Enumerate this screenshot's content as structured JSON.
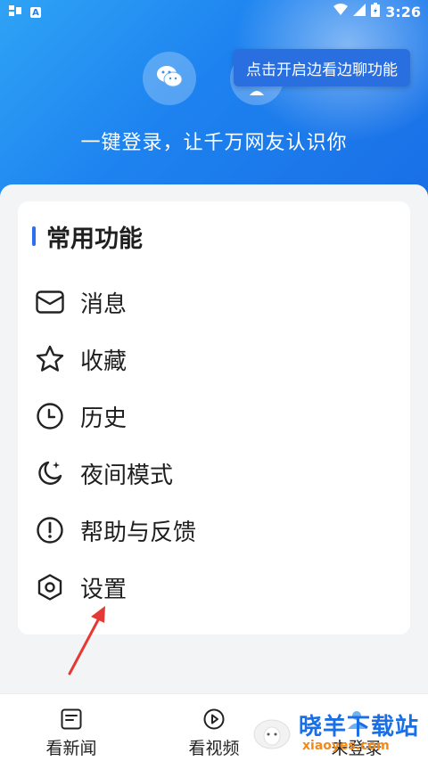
{
  "status_bar": {
    "left_icons": [
      "notification-icon",
      "a-icon"
    ],
    "a_label": "A",
    "time": "3:26",
    "right_icons": [
      "wifi-icon",
      "signal-icon",
      "battery-icon"
    ]
  },
  "header": {
    "tooltip": "点击开启边看边聊功能",
    "login_prompt": "一键登录，让千万网友认识你",
    "icons": [
      "wechat-icon",
      "user-icon"
    ]
  },
  "section": {
    "title": "常用功能",
    "items": [
      {
        "label": "消息",
        "icon": "envelope-icon"
      },
      {
        "label": "收藏",
        "icon": "star-icon"
      },
      {
        "label": "历史",
        "icon": "clock-icon"
      },
      {
        "label": "夜间模式",
        "icon": "moon-icon"
      },
      {
        "label": "帮助与反馈",
        "icon": "exclamation-icon"
      },
      {
        "label": "设置",
        "icon": "hexagon-settings-icon"
      }
    ]
  },
  "bottom_nav": [
    {
      "label": "看新闻",
      "icon": "news-icon"
    },
    {
      "label": "看视频",
      "icon": "play-icon"
    },
    {
      "label": "未登录",
      "icon": "user-icon"
    }
  ],
  "watermark": {
    "title": "晓羊下载站",
    "url": "xiaoyes.com"
  },
  "colors": {
    "accent": "#2d6ff0",
    "hero_start": "#2fa3f5",
    "hero_end": "#1a6fe6",
    "arrow": "#e53935",
    "watermark_orange": "#f08a1c"
  }
}
